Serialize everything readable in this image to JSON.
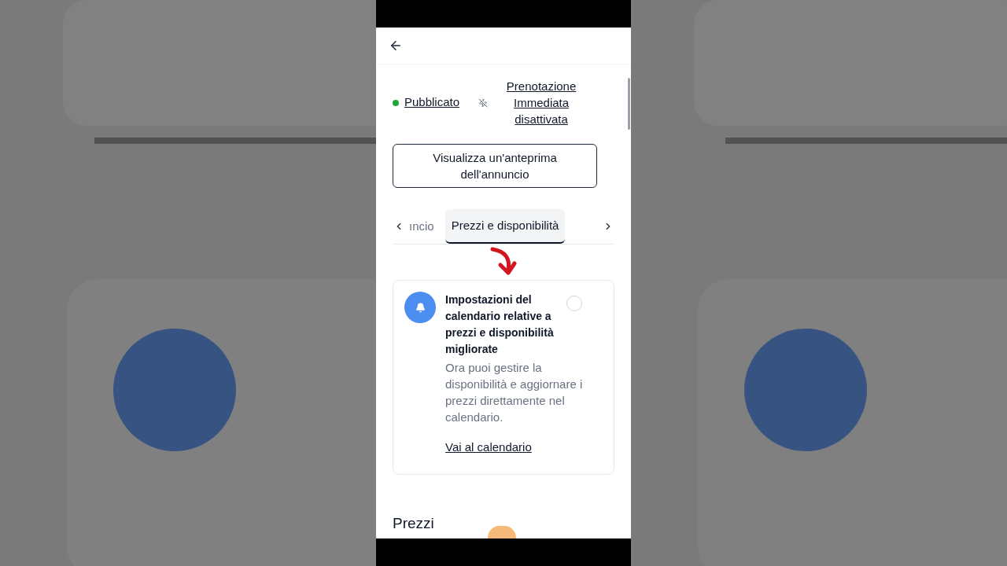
{
  "status": {
    "published": {
      "label": "Pubblicato",
      "color": "#1ea83a"
    },
    "instant_booking": {
      "label": "Prenotazione Immediata disattivata"
    }
  },
  "preview_button": "Visualizza un'anteprima dell'annuncio",
  "tabs": [
    {
      "label": "ıncio",
      "selected": false
    },
    {
      "label": "Prezzi e disponibilità",
      "selected": true
    }
  ],
  "notice": {
    "title": "Impostazioni del calendario relative a prezzi e disponibilità migliorate",
    "body": "Ora puoi gestire la disponibilità e aggiornare i prezzi direttamente nel calendario.",
    "link": "Vai al calendario",
    "selected": false
  },
  "section_title": "Prezzi"
}
